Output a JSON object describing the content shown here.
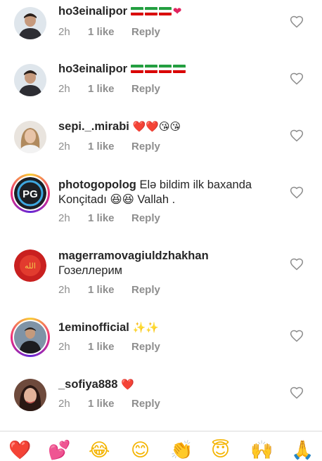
{
  "comments": [
    {
      "username": "ho3einalipor",
      "text": "",
      "emoji": "🇮🇷🇮🇷🇮🇷❤️",
      "time": "2h",
      "likes": "1 like",
      "reply": "Reply"
    },
    {
      "username": "ho3einalipor",
      "text": "",
      "emoji": "🇮🇷🇮🇷🇮🇷🇮🇷",
      "time": "2h",
      "likes": "1 like",
      "reply": "Reply"
    },
    {
      "username": "sepi._.mirabi",
      "text": "",
      "emoji": "❤️❤️😘😘",
      "time": "2h",
      "likes": "1 like",
      "reply": "Reply"
    },
    {
      "username": "photogopolog",
      "text": "Elə bildim ilk baxanda Konçitadı 😆😆 Vallah .",
      "emoji": "",
      "time": "2h",
      "likes": "1 like",
      "reply": "Reply"
    },
    {
      "username": "magerramovagiuldzhakhan",
      "text": "Гозеллерим",
      "emoji": "",
      "time": "2h",
      "likes": "1 like",
      "reply": "Reply"
    },
    {
      "username": "1eminofficial",
      "text": "",
      "emoji": "✨✨",
      "time": "2h",
      "likes": "1 like",
      "reply": "Reply"
    },
    {
      "username": "_sofiya888",
      "text": "",
      "emoji": "❤️",
      "time": "2h",
      "likes": "1 like",
      "reply": "Reply"
    }
  ],
  "emoji_tray": [
    "❤️",
    "💕",
    "😂",
    "😊",
    "👏",
    "😇",
    "🙌",
    "🙏"
  ],
  "colors": {
    "meta": "#8e8e8e",
    "text": "#262626",
    "heart": "#e0245e"
  }
}
